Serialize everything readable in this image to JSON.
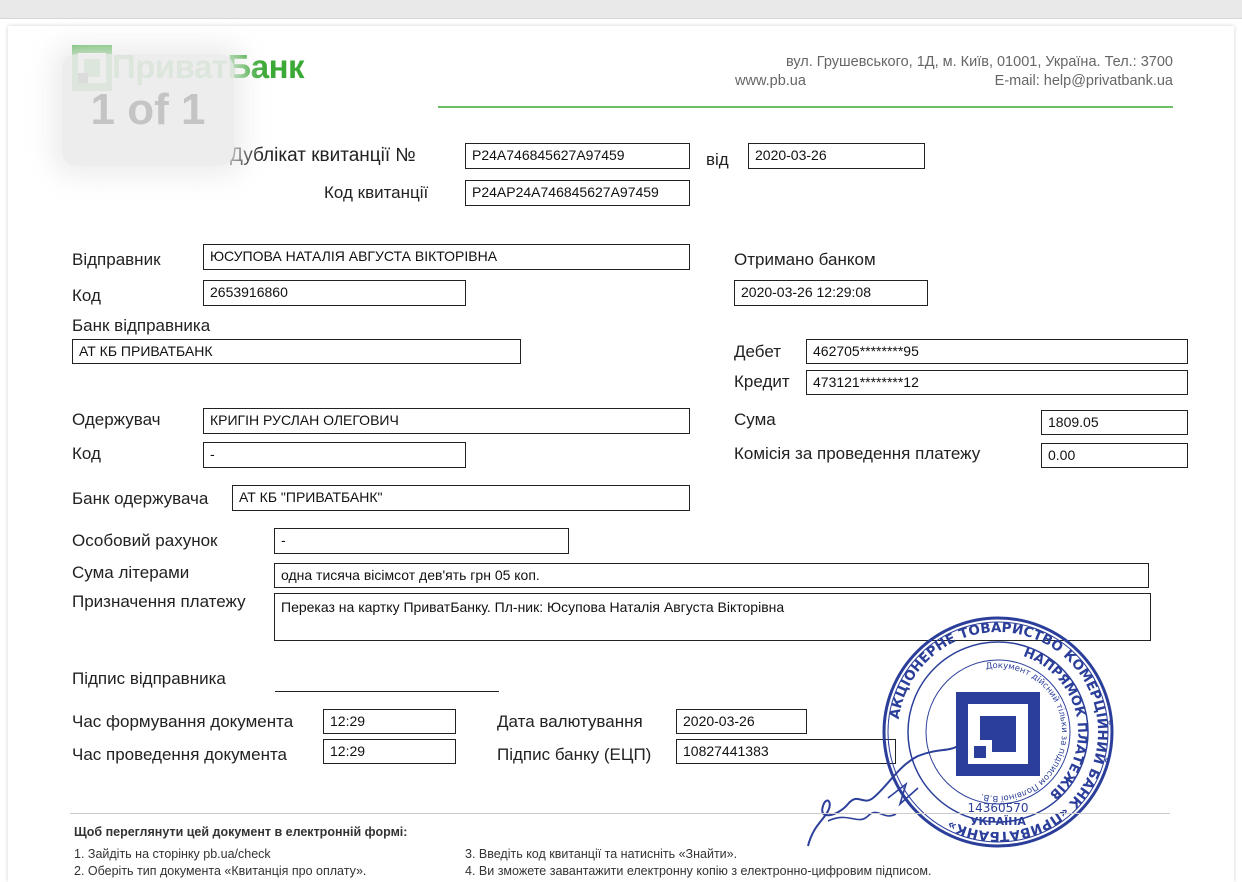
{
  "bank": {
    "name": "ПриватБанк",
    "address_line1": "вул. Грушевського, 1Д, м. Київ, 01001, Україна. Тел.: 3700",
    "website": "www.pb.ua",
    "email": "E-mail: help@privatbank.ua",
    "brand_color": "#3aa935"
  },
  "pager": "1 of 1",
  "receipt": {
    "duplicate_label": "Дублікат квитанції №",
    "duplicate_number": "P24A746845627A97459",
    "date_label": "від",
    "date": "2020-03-26",
    "code_label": "Код квитанції",
    "code": "P24AP24A746845627A97459"
  },
  "sender": {
    "label": "Відправник",
    "name": "ЮСУПОВА НАТАЛІЯ АВГУСТА ВІКТОРІВНА",
    "code_label": "Код",
    "code": "2653916860",
    "bank_label": "Банк відправника",
    "bank": "АТ КБ ПРИВАТБАНК"
  },
  "received": {
    "label": "Отримано банком",
    "value": "2020-03-26 12:29:08"
  },
  "debit": {
    "label": "Дебет",
    "value": "462705********95"
  },
  "credit": {
    "label": "Кредит",
    "value": "473121********12"
  },
  "amount": {
    "label": "Сума",
    "value": "1809.05"
  },
  "commission": {
    "label": "Комісія за проведення платежу",
    "value": "0.00"
  },
  "recipient": {
    "label": "Одержувач",
    "name": "КРИГІН РУСЛАН ОЛЕГОВИЧ",
    "code_label": "Код",
    "code": "-",
    "bank_label": "Банк одержувача",
    "bank": "АТ КБ \"ПРИВАТБАНК\""
  },
  "personal_account": {
    "label": "Особовий рахунок",
    "value": "-"
  },
  "amount_words": {
    "label": "Сума літерами",
    "value": "одна тисяча вісімсот дев'ять грн 05 коп."
  },
  "purpose": {
    "label": "Призначення платежу",
    "value": "Переказ на картку ПриватБанку. Пл-ник: Юсупова Наталія Августа Вікторівна"
  },
  "sender_signature_label": "Підпис відправника",
  "doc_time": {
    "label": "Час формування документа",
    "value": "12:29"
  },
  "proc_time": {
    "label": "Час проведення документа",
    "value": "12:29"
  },
  "value_date": {
    "label": "Дата валютування",
    "value": "2020-03-26"
  },
  "bank_signature": {
    "label": "Підпис банку (ЕЦП)",
    "value": "10827441383"
  },
  "help": {
    "title": "Щоб переглянути цей документ в електронній формі:",
    "step1": "1. Зайдіть на сторінку pb.ua/check",
    "step2": "2. Оберіть тип документа «Квитанція про оплату».",
    "step3": "3. Введіть код квитанції та натисніть «Знайти».",
    "step4": "4. Ви зможете завантажити електронну копію з електронно-цифровим підписом."
  },
  "stamp": {
    "outer_text": "АКЦІОНЕРНЕ ТОВАРИСТВО КОМЕРЦІЙНИЙ БАНК «ПРИВАТБАНК»",
    "inner_text": "НАПРЯМОК ПЛАТЕЖІВ",
    "small_text": "Документ дійсний тільки за підписом Полвіної В.В.",
    "code": "14360570",
    "country": "УКРАЇНА",
    "color": "#2b3f9a"
  }
}
